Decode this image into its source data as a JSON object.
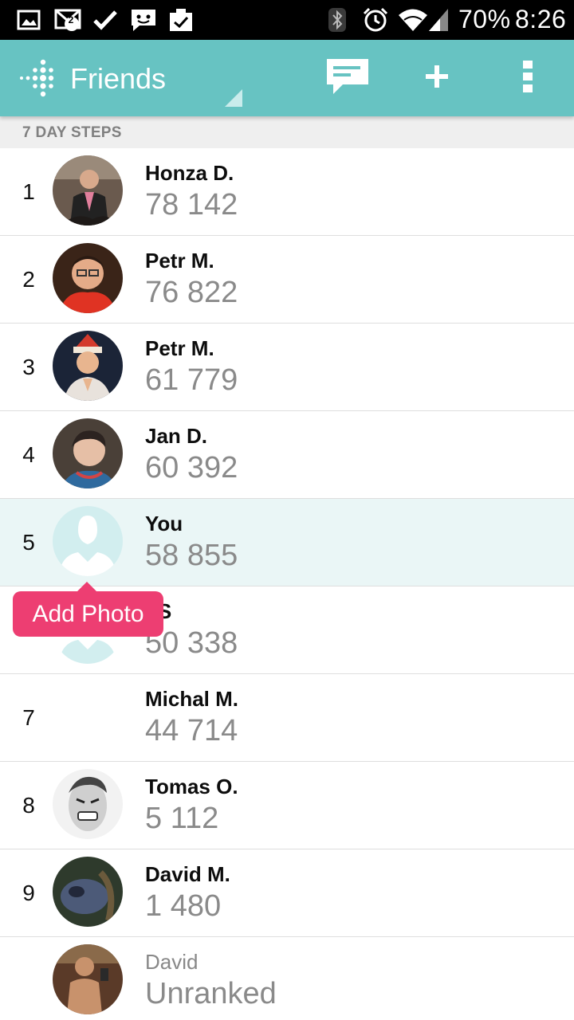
{
  "status_bar": {
    "battery": "70%",
    "time": "8:26",
    "icons": [
      "image-icon",
      "gmail-icon",
      "check-icon",
      "chat-icon",
      "clipboard-check-icon",
      "bluetooth-icon",
      "alarm-icon",
      "wifi-icon",
      "signal-icon"
    ],
    "badge_count": "2"
  },
  "app_bar": {
    "title": "Friends",
    "icons": [
      "fitbit-logo-icon",
      "message-icon",
      "add-icon",
      "overflow-menu-icon"
    ]
  },
  "section_header": "7 DAY STEPS",
  "leaderboard": [
    {
      "rank": "1",
      "name": "Honza D.",
      "steps": "78 142",
      "avatar": "photo"
    },
    {
      "rank": "2",
      "name": "Petr M.",
      "steps": "76 822",
      "avatar": "photo"
    },
    {
      "rank": "3",
      "name": "Petr M.",
      "steps": "61 779",
      "avatar": "photo"
    },
    {
      "rank": "4",
      "name": "Jan D.",
      "steps": "60 392",
      "avatar": "photo"
    },
    {
      "rank": "5",
      "name": "You",
      "steps": "58 855",
      "avatar": "placeholder"
    },
    {
      "rank": "",
      "name": "nS",
      "steps": "50 338",
      "avatar": "placeholder"
    },
    {
      "rank": "7",
      "name": "Michal M.",
      "steps": "44 714",
      "avatar": "none"
    },
    {
      "rank": "8",
      "name": "Tomas O.",
      "steps": "5 112",
      "avatar": "photo"
    },
    {
      "rank": "9",
      "name": "David M.",
      "steps": "1 480",
      "avatar": "photo"
    },
    {
      "rank": "",
      "name": "David",
      "steps": "Unranked",
      "avatar": "photo"
    }
  ],
  "tooltip": {
    "label": "Add Photo"
  },
  "colors": {
    "app_bar": "#67c3c2",
    "highlight_row": "#eaf6f6",
    "tooltip": "#ed3e72",
    "section_header_bg": "#efefef"
  }
}
